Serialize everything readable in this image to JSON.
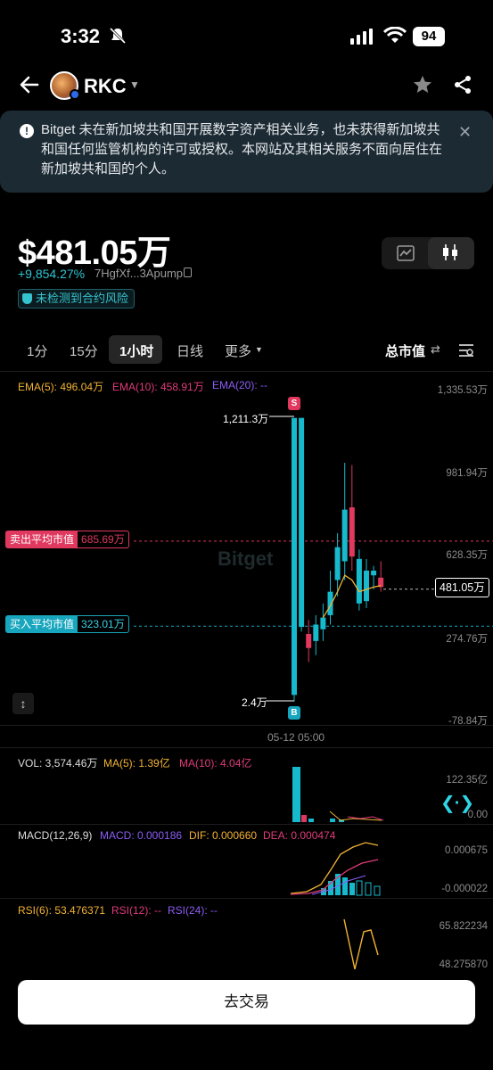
{
  "status_bar": {
    "time": "3:32",
    "battery": "94"
  },
  "header": {
    "ticker": "RKC"
  },
  "notice": {
    "text": "Bitget 未在新加坡共和国开展数字资产相关业务，也未获得新加坡共和国任何监管机构的许可或授权。本网站及其相关服务不面向居住在新加坡共和国的个人。"
  },
  "price": {
    "market_cap": "$481.05万",
    "change": "+9,854.27%",
    "address": "7HgfXf...3Apump",
    "risk_badge": "未检测到合约风险"
  },
  "tabs": {
    "t1": "1分",
    "t2": "15分",
    "t3": "1小时",
    "t4": "日线",
    "more": "更多",
    "active": "1小时"
  },
  "toolbar": {
    "metric": "总市值",
    "swap_glyph": "⇄"
  },
  "chart": {
    "watermark": "Bitget",
    "ema": {
      "ema5": "EMA(5): 496.04万",
      "ema10": "EMA(10): 458.91万",
      "ema20": "EMA(20): --"
    },
    "y_ticks": {
      "t1": "1,335.53万",
      "t2": "981.94万",
      "t3": "628.35万",
      "t4": "274.76万",
      "t5": "-78.84万"
    },
    "sell_avg": {
      "label": "卖出平均市值",
      "value": "685.69万"
    },
    "buy_avg": {
      "label": "买入平均市值",
      "value": "323.01万"
    },
    "current": "481.05万",
    "high_label": "1,211.3万",
    "low_label": "2.4万",
    "sell_marker": "S",
    "buy_marker": "B",
    "time_label": "05-12 05:00"
  },
  "chart_data": {
    "type": "candlestick",
    "unit": "万",
    "ylim": [
      -78.84,
      1335.53
    ],
    "candles": [
      {
        "open": 30,
        "close": 1211.3,
        "high": 1211.3,
        "low": 2.4,
        "color": "up"
      },
      {
        "open": 1211.3,
        "close": 320,
        "high": 1211.3,
        "low": 300,
        "color": "up"
      },
      {
        "open": 230,
        "close": 290,
        "high": 350,
        "low": 170,
        "color": "down"
      },
      {
        "open": 260,
        "close": 330,
        "high": 370,
        "low": 200,
        "color": "up"
      },
      {
        "open": 310,
        "close": 360,
        "high": 420,
        "low": 260,
        "color": "up"
      },
      {
        "open": 370,
        "close": 470,
        "high": 560,
        "low": 330,
        "color": "up"
      },
      {
        "open": 520,
        "close": 660,
        "high": 720,
        "low": 450,
        "color": "up"
      },
      {
        "open": 600,
        "close": 820,
        "high": 1020,
        "low": 520,
        "color": "up"
      },
      {
        "open": 830,
        "close": 620,
        "high": 1010,
        "low": 560,
        "color": "down"
      },
      {
        "open": 610,
        "close": 420,
        "high": 650,
        "low": 390,
        "color": "up"
      },
      {
        "open": 430,
        "close": 560,
        "high": 610,
        "low": 400,
        "color": "up"
      },
      {
        "open": 560,
        "close": 540,
        "high": 580,
        "low": 480,
        "color": "up"
      },
      {
        "open": 530,
        "close": 490,
        "high": 600,
        "low": 470,
        "color": "down"
      }
    ],
    "ema5": [
      null,
      null,
      null,
      null,
      360,
      410,
      470,
      540,
      520,
      470,
      480,
      490,
      496.04
    ],
    "sell_avg": 685.69,
    "buy_avg": 323.01,
    "current": 481.05
  },
  "volume": {
    "vol": "VOL: 3,574.46万",
    "ma5": "MA(5): 1.39亿",
    "ma10": "MA(10): 4.04亿",
    "tick_high": "122.35亿",
    "tick_low": "0.00"
  },
  "macd": {
    "title": "MACD(12,26,9)",
    "macd": "MACD: 0.000186",
    "dif": "DIF: 0.000660",
    "dea": "DEA: 0.000474",
    "tick_high": "0.000675",
    "tick_low": "-0.000022"
  },
  "rsi": {
    "rsi6": "RSI(6): 53.476371",
    "rsi12": "RSI(12): --",
    "rsi24": "RSI(24): --",
    "tick_high": "65.822234",
    "tick_low": "48.275870"
  },
  "cta": {
    "trade": "去交易"
  },
  "colors": {
    "up": "#17b9cc",
    "down": "#e0385e",
    "ema5": "#f2b233",
    "ema10": "#e03b7a",
    "ema20": "#8b5cf6"
  }
}
